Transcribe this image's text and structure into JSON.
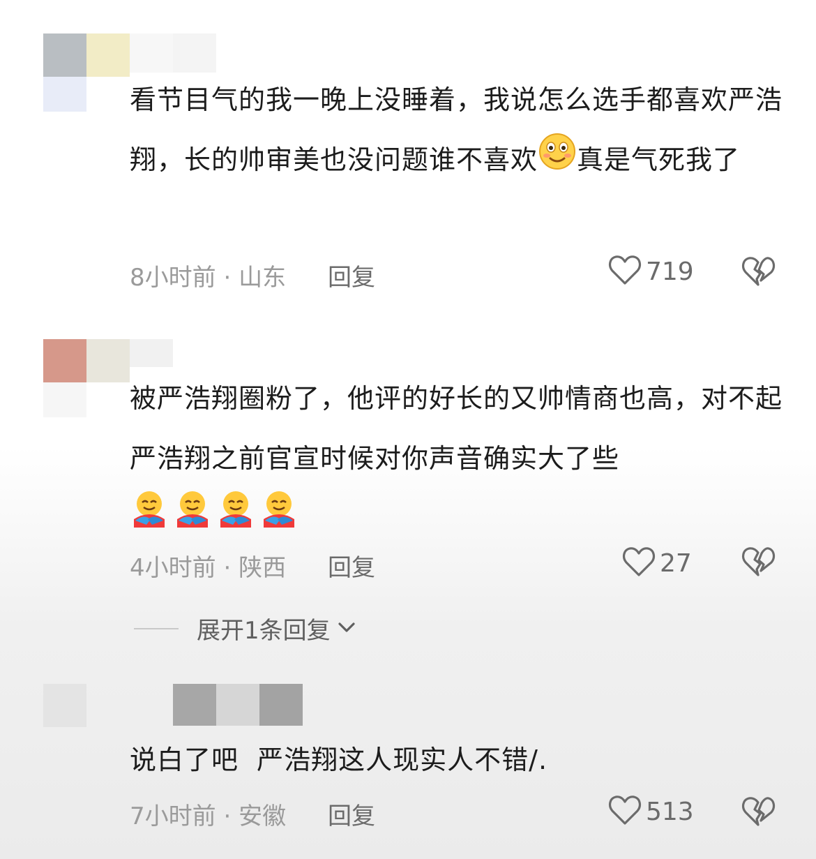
{
  "comments": [
    {
      "text_a": "看节目气的我一晚上没睡着，我说怎么选手都喜欢严浩翔，长的帅审美也没问题谁不喜欢",
      "emoji": "smiling-face",
      "text_b": "真是气死我了",
      "time": "8小时前",
      "location": "山东",
      "reply_label": "回复",
      "likes": "719"
    },
    {
      "text_a": "被严浩翔圈粉了，他评的好长的又帅情商也高，对不起严浩翔之前官宣时候对你声音确实大了些",
      "emoji": "hugging-face x4",
      "time": "4小时前",
      "location": "陕西",
      "reply_label": "回复",
      "likes": "27",
      "expand_label": "展开1条回复"
    },
    {
      "text_a": "说白了吧  严浩翔这人现实人不错/.",
      "time": "7小时前",
      "location": "安徽",
      "reply_label": "回复",
      "likes": "513"
    }
  ],
  "colors": {
    "meta_gray": "#9a9a9a",
    "text": "#1c1c1c",
    "icon_gray": "#6b6b6b"
  },
  "icons": [
    "heart-outline-icon",
    "broken-heart-icon",
    "chevron-down-icon"
  ]
}
